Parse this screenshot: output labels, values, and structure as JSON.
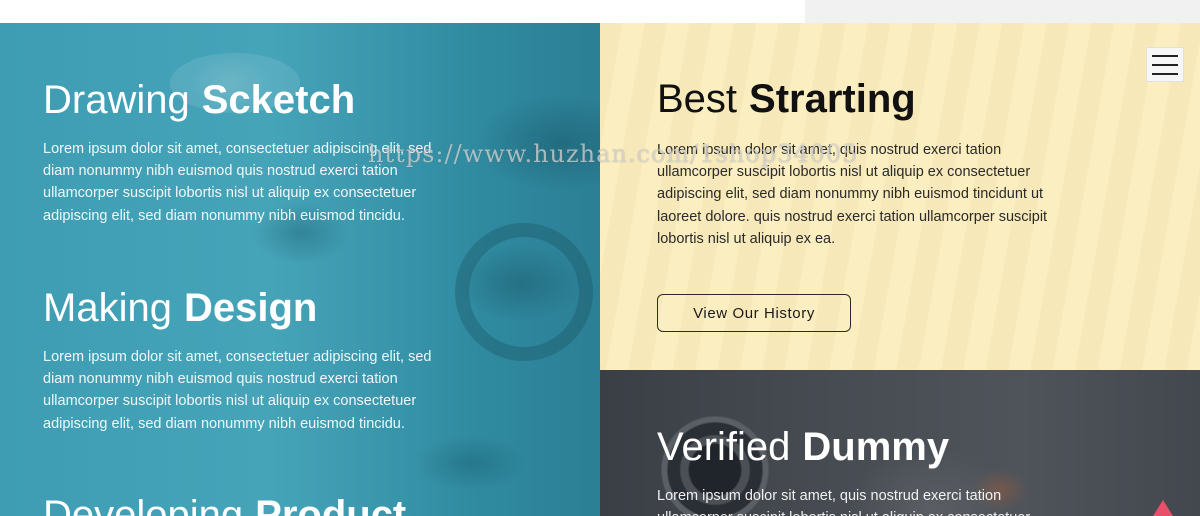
{
  "left_panel": {
    "blocks": [
      {
        "title_light": "Drawing",
        "title_bold": "Scketch",
        "text": "Lorem ipsum dolor sit amet, consectetuer adipiscing elit, sed diam nonummy nibh euismod quis nostrud exerci tation ullamcorper suscipit lobortis nisl ut aliquip ex consectetuer adipiscing elit, sed diam nonummy nibh euismod tincidu."
      },
      {
        "title_light": "Making",
        "title_bold": "Design",
        "text": "Lorem ipsum dolor sit amet, consectetuer adipiscing elit, sed diam nonummy nibh euismod quis nostrud exerci tation ullamcorper suscipit lobortis nisl ut aliquip ex consectetuer adipiscing elit, sed diam nonummy nibh euismod tincidu."
      },
      {
        "title_light": "Developing",
        "title_bold": "Product",
        "text": ""
      }
    ]
  },
  "right_top": {
    "title_light": "Best",
    "title_bold": "Strarting",
    "text": "Lorem ipsum dolor sit amet, quis nostrud exerci tation ullamcorper suscipit lobortis nisl ut aliquip ex consectetuer adipiscing elit, sed diam nonummy nibh euismod tincidunt ut laoreet dolore. quis nostrud exerci tation ullamcorper suscipit lobortis nisl ut aliquip ex ea.",
    "button_label": "View Our History"
  },
  "right_bottom": {
    "title_light": "Verified",
    "title_bold": "Dummy",
    "text": "Lorem ipsum dolor sit amet, quis nostrud exerci tation ullamcorper suscipit lobortis nisl ut aliquip ex consectetuer"
  },
  "watermark": "https://www.huzhan.com/1shop34005",
  "icons": {
    "menu": "hamburger-menu-icon",
    "scroll_top": "scroll-to-top-arrow-icon"
  },
  "colors": {
    "teal": "#3e9db3",
    "cream": "#fbeec0",
    "dark": "#474c53",
    "accent": "#e8506a"
  }
}
